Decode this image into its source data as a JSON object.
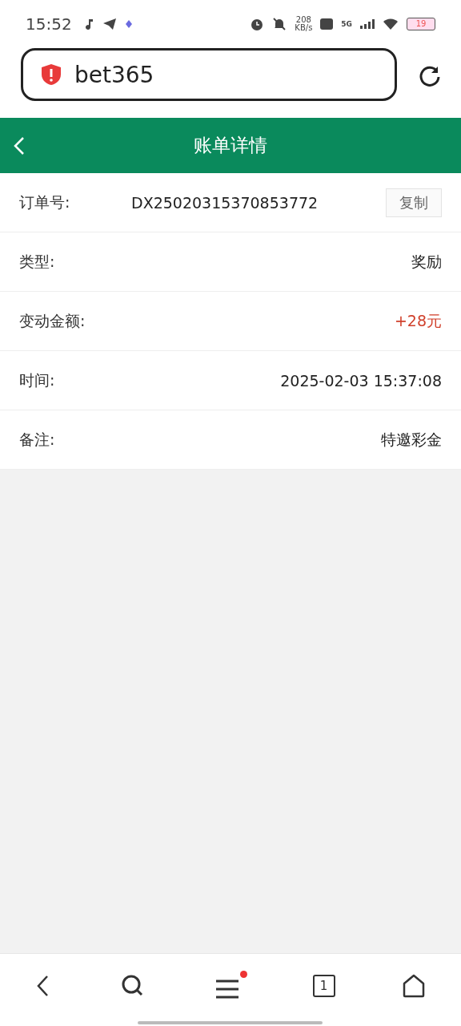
{
  "status_bar": {
    "time": "15:52",
    "speed": "208",
    "speed_unit": "KB/s",
    "network": "5G",
    "battery": "19"
  },
  "browser": {
    "url": "bet365"
  },
  "header": {
    "title": "账单详情"
  },
  "rows": [
    {
      "label": "订单号:",
      "value": "DX25020315370853772",
      "button": "复制",
      "kind": "copy",
      "highlight": false
    },
    {
      "label": "类型:",
      "value": "奖励",
      "kind": "plain",
      "highlight": false
    },
    {
      "label": "变动金额:",
      "value": "+28元",
      "kind": "plain",
      "highlight": true
    },
    {
      "label": "时间:",
      "value": "2025-02-03 15:37:08",
      "kind": "plain",
      "highlight": false
    },
    {
      "label": "备注:",
      "value": "特邀彩金",
      "kind": "plain",
      "highlight": false
    }
  ],
  "bottom_nav": {
    "tab_count": "1",
    "menu_badge": true
  }
}
